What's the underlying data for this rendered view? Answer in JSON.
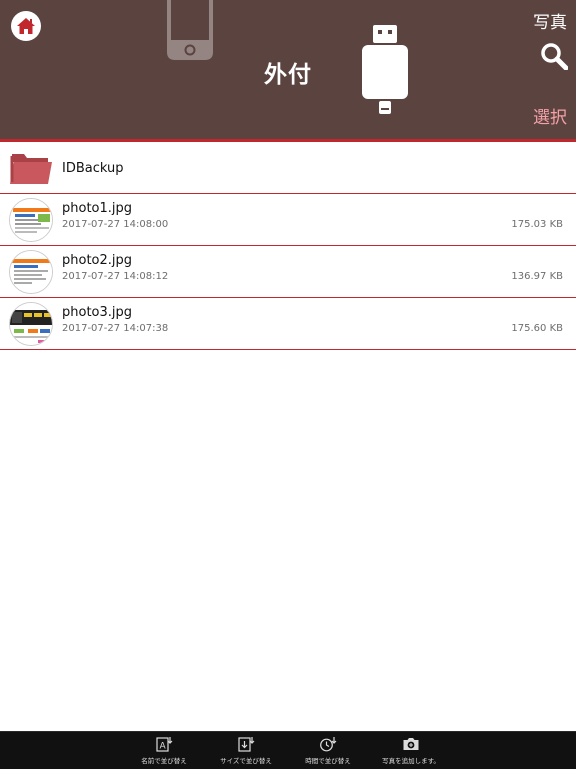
{
  "header": {
    "title": "外付",
    "photos_label": "写真",
    "select_label": "選択",
    "colors": {
      "background": "#5b4340",
      "accent": "#c0282d",
      "select": "#f4a1a8"
    }
  },
  "icons": {
    "home": "home-icon",
    "phone": "phone-icon",
    "usb": "usb-drive-icon",
    "search": "search-icon",
    "folder": "folder-icon"
  },
  "list": {
    "folder": {
      "name": "IDBackup"
    },
    "files": [
      {
        "name": "photo1.jpg",
        "date": "2017-07-27 14:08:00",
        "size": "175.03 KB"
      },
      {
        "name": "photo2.jpg",
        "date": "2017-07-27 14:08:12",
        "size": "136.97 KB"
      },
      {
        "name": "photo3.jpg",
        "date": "2017-07-27 14:07:38",
        "size": "175.60 KB"
      }
    ]
  },
  "toolbar": {
    "sort_name": "名前で並び替え",
    "sort_size": "サイズで並び替え",
    "sort_time": "時間で並び替え",
    "add_photo": "写真を追加します。"
  }
}
